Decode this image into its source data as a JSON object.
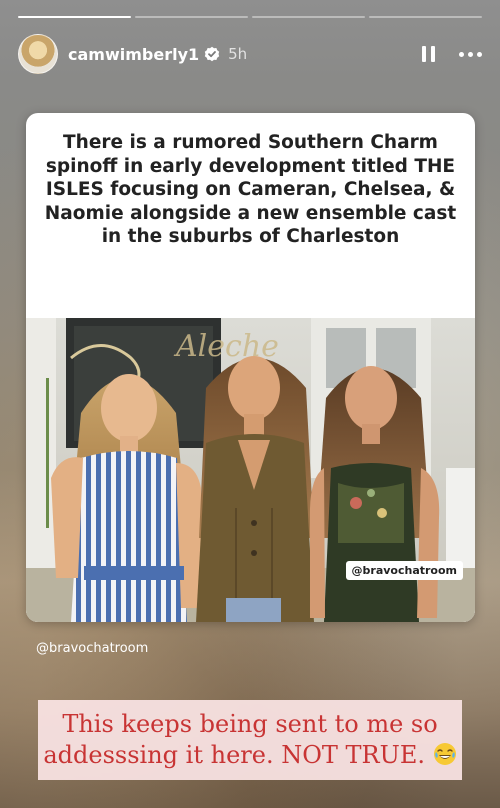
{
  "story": {
    "progress": [
      {
        "state": "done"
      },
      {
        "state": "active"
      },
      {
        "state": "pending"
      },
      {
        "state": "pending"
      }
    ],
    "user": {
      "username": "camwimberly1",
      "verified": true,
      "time": "5h"
    },
    "controls": {
      "pause_icon": "pause-icon",
      "more_icon": "more-icon"
    }
  },
  "post": {
    "headline": "There is a rumored Southern Charm spinoff in early development titled THE ISLES focusing on Cameran, Chelsea, & Naomie alongside a new ensemble cast in the suburbs of Charleston",
    "photo_tag": "@bravochatroom",
    "photo_sign": "Aleche"
  },
  "credit": "@bravochatroom",
  "caption": {
    "text": "This keeps being sent to me so addesssing it here. NOT TRUE.",
    "emoji": "laughing-crying-emoji",
    "color": "#c83434"
  },
  "colors": {
    "verified": "#3897f0"
  }
}
